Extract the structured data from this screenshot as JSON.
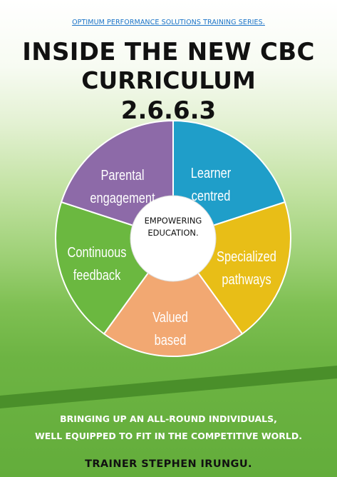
{
  "header": {
    "series": "OPTIMUM PERFORMANCE SOLUTIONS TRAINING SERIES.",
    "title_line1": "INSIDE THE NEW CBC",
    "title_line2": "CURRICULUM",
    "title_line3": "2.6.6.3"
  },
  "wheel": {
    "center_line1": "EMPOWERING",
    "center_line2": "EDUCATION.",
    "segments": [
      {
        "line1": "Learner",
        "line2": "centred",
        "color": "#1f9ec9"
      },
      {
        "line1": "Specialized",
        "line2": "pathways",
        "color": "#e8be17"
      },
      {
        "line1": "Valued",
        "line2": "based",
        "color": "#f2a872"
      },
      {
        "line1": "Continuous",
        "line2": "feedback",
        "color": "#6bb840"
      },
      {
        "line1": "Parental",
        "line2": "engagement",
        "color": "#8d6aa8"
      }
    ]
  },
  "footer": {
    "tagline_line1": "BRINGING UP AN ALL-ROUND INDIVIDUALS,",
    "tagline_line2": "WELL EQUIPPED TO FIT IN THE COMPETITIVE WORLD.",
    "trainer": "TRAINER STEPHEN IRUNGU."
  },
  "colors": {
    "series_link": "#1a73c8",
    "stripe": "#4a8f2a",
    "center_fill": "#ffffff"
  }
}
